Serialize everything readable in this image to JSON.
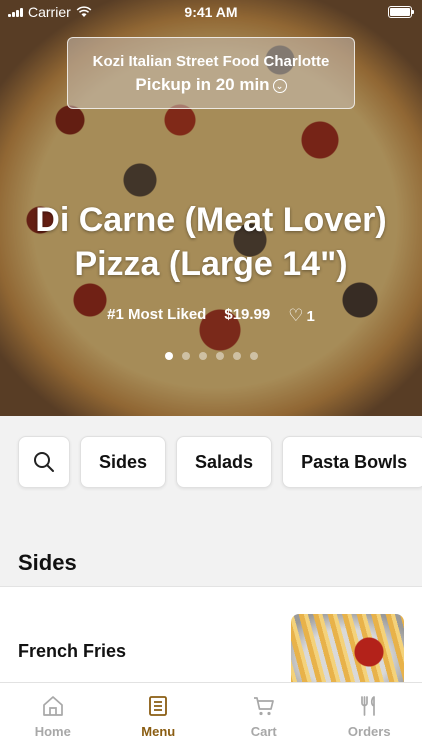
{
  "status_bar": {
    "carrier": "Carrier",
    "time": "9:41 AM"
  },
  "store": {
    "name": "Kozi Italian Street Food Charlotte",
    "pickup": "Pickup in 20 min"
  },
  "featured": {
    "title": "Di Carne (Meat Lover) Pizza (Large 14\")",
    "rank": "#1 Most Liked",
    "price": "$19.99",
    "likes": "1",
    "carousel": {
      "count": 6,
      "active_index": 0
    }
  },
  "categories": [
    "Sides",
    "Salads",
    "Pasta Bowls"
  ],
  "section": {
    "title": "Sides"
  },
  "items": [
    {
      "name": "French Fries"
    }
  ],
  "tabs": [
    {
      "label": "Home",
      "icon": "home-icon",
      "active": false
    },
    {
      "label": "Menu",
      "icon": "menu-icon",
      "active": true
    },
    {
      "label": "Cart",
      "icon": "cart-icon",
      "active": false
    },
    {
      "label": "Orders",
      "icon": "orders-icon",
      "active": false
    }
  ],
  "colors": {
    "accent": "#8a5d12",
    "inactive": "#a8a8a8"
  }
}
